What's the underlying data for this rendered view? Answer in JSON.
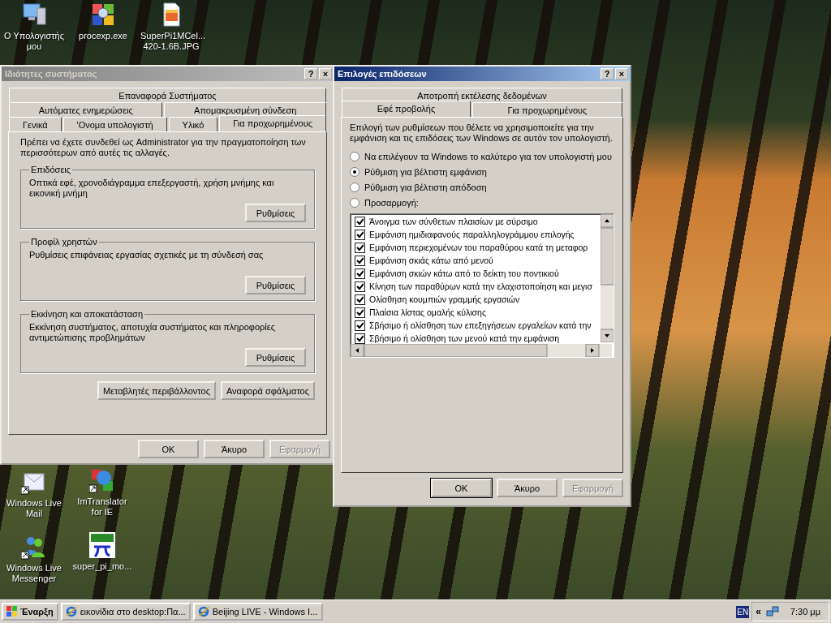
{
  "desktop_icons": [
    {
      "label": "Ο Υπολογιστής μου",
      "kind": "computer"
    },
    {
      "label": "procexp.exe",
      "kind": "program"
    },
    {
      "label": "SuperPi1MCel... 420-1.6B.JPG",
      "kind": "image"
    },
    {
      "label": "Windows Live Mail",
      "kind": "mail"
    },
    {
      "label": "ImTranslator for IE",
      "kind": "translator"
    },
    {
      "label": "Windows Live Messenger",
      "kind": "messenger"
    },
    {
      "label": "super_pi_mo...",
      "kind": "superpi"
    }
  ],
  "system_properties": {
    "title": "Ιδιότητες συστήματος",
    "active": false,
    "title_buttons": [
      "?",
      "×"
    ],
    "tab_rows": [
      [
        {
          "label": "Επαναφορά Συστήματος",
          "selected": false
        }
      ],
      [
        {
          "label": "Αυτόματες ενημερώσεις",
          "selected": false
        },
        {
          "label": "Απομακρυσμένη σύνδεση",
          "selected": false
        }
      ],
      [
        {
          "label": "Γενικά",
          "selected": false
        },
        {
          "label": "'Ονομα υπολογιστή",
          "selected": false
        },
        {
          "label": "Υλικό",
          "selected": false
        },
        {
          "label": "Για προχωρημένους",
          "selected": true
        }
      ]
    ],
    "intro": "Πρέπει να έχετε συνδεθεί ως Administrator για την πραγματοποίηση των περισσότερων από αυτές τις αλλαγές.",
    "groups": [
      {
        "title": "Επιδόσεις",
        "text": "Οπτικά εφέ, χρονοδιάγραμμα επεξεργαστή, χρήση μνήμης και εικονική μνήμη",
        "button": "Ρυθμίσεις"
      },
      {
        "title": "Προφίλ χρηστών",
        "text": "Ρυθμίσεις επιφάνειας εργασίας σχετικές με τη σύνδεσή σας",
        "button": "Ρυθμίσεις"
      },
      {
        "title": "Εκκίνηση και αποκατάσταση",
        "text": "Εκκίνηση συστήματος, αποτυχία συστήματος και πληροφορίες αντιμετώπισης προβλημάτων",
        "button": "Ρυθμίσεις"
      }
    ],
    "extra_buttons": [
      "Μεταβλητές περιβάλλοντος",
      "Αναφορά σφάλματος"
    ],
    "buttons": [
      {
        "label": "OK",
        "disabled": false,
        "default": false
      },
      {
        "label": "Άκυρο",
        "disabled": false,
        "default": false
      },
      {
        "label": "Εφαρμογή",
        "disabled": true,
        "default": false
      }
    ]
  },
  "performance_options": {
    "title": "Επιλογές επιδόσεων",
    "active": true,
    "title_buttons": [
      "?",
      "×"
    ],
    "tab_rows": [
      [
        {
          "label": "Αποτροπή εκτέλεσης δεδομένων",
          "selected": false
        }
      ],
      [
        {
          "label": "Εφέ προβολής",
          "selected": true
        },
        {
          "label": "Για προχωρημένους",
          "selected": false
        }
      ]
    ],
    "intro": "Επιλογή των ρυθμίσεων που θέλετε να χρησιμοποιείτε για την εμφάνιση και τις επιδόσεις των Windows σε αυτόν τον υπολογιστή.",
    "options": [
      {
        "label": "Να επιλέγουν τα Windows το καλύτερο για τον υπολογιστή μου",
        "selected": false
      },
      {
        "label": "Ρύθμιση για βέλτιστη εμφάνιση",
        "selected": true
      },
      {
        "label": "Ρύθμιση για βέλτιστη απόδοση",
        "selected": false
      },
      {
        "label": "Προσαρμογή:",
        "selected": false
      }
    ],
    "effects": [
      {
        "label": "Άνοιγμα των σύνθετων πλαισίων με σύρσιμο",
        "checked": true
      },
      {
        "label": "Εμφάνιση ημιδιαφανούς παραλληλογράμμου επιλογής",
        "checked": true
      },
      {
        "label": "Εμφάνιση περιεχομένων του παραθύρου κατά τη μεταφορ",
        "checked": true
      },
      {
        "label": "Εμφάνιση σκιάς κάτω από μενού",
        "checked": true
      },
      {
        "label": "Εμφάνιση σκιών κάτω από το δείκτη του ποντικιού",
        "checked": true
      },
      {
        "label": "Κίνηση των παραθύρων κατά την ελαχιστοποίηση και μεγισ",
        "checked": true
      },
      {
        "label": "Ολίσθηση κουμπιών γραμμής εργασιών",
        "checked": true
      },
      {
        "label": "Πλαίσια λίστας ομαλής κύλισης",
        "checked": true
      },
      {
        "label": "Σβήσιμο ή ολίσθηση των επεξηγήσεων εργαλείων κατά την",
        "checked": true
      },
      {
        "label": "Σβήσιμο ή ολίσθηση των μενού κατά την εμφάνιση",
        "checked": true
      }
    ],
    "buttons": [
      {
        "label": "OK",
        "disabled": false,
        "default": true
      },
      {
        "label": "Άκυρο",
        "disabled": false,
        "default": false
      },
      {
        "label": "Εφαρμογή",
        "disabled": true,
        "default": false
      }
    ]
  },
  "taskbar": {
    "start": "Έναρξη",
    "tasks": [
      "εικονίδια στο desktop:Πα...",
      "Beijing LIVE - Windows I..."
    ],
    "language": "EN",
    "tray_toggle": "«",
    "clock": "7:30 μμ"
  }
}
